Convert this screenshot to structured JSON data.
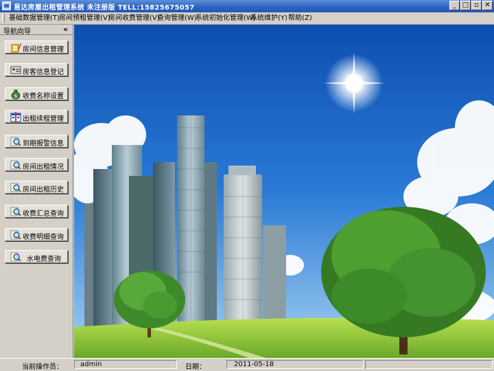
{
  "window": {
    "title": "易达房屋出租管理系统 未注册版  TELL:15825675057",
    "controls": {
      "minimize": "_",
      "maximize": "□",
      "restore": "▫",
      "close": "✕"
    }
  },
  "menu": {
    "items": [
      "基础数据管理(T)",
      "房间预租管理(V)",
      "房间收费管理(V)",
      "查询管理(W)",
      "系统初始化管理(W)",
      "系统维护(Y)",
      "帮助(Z)"
    ]
  },
  "nav": {
    "title": "导航向导",
    "collapse": "«",
    "items": [
      {
        "label": "房间信息管理",
        "icon": "house-edit-icon"
      },
      {
        "label": "房客信息登记",
        "icon": "tenant-card-icon"
      },
      {
        "label": "收费名称设置",
        "icon": "money-bag-icon"
      },
      {
        "label": "出租续租管理",
        "icon": "rent-calendar-icon"
      },
      {
        "label": "到期报警信息",
        "icon": "magnifier-alert-icon"
      },
      {
        "label": "房间出租情况",
        "icon": "magnifier-report-icon"
      },
      {
        "label": "房间出租历史",
        "icon": "magnifier-history-icon"
      },
      {
        "label": "收费汇总查询",
        "icon": "magnifier-summary-icon"
      },
      {
        "label": "收费明细查询",
        "icon": "magnifier-detail-icon"
      },
      {
        "label": "水电费查询",
        "icon": "magnifier-utility-icon"
      }
    ]
  },
  "status": {
    "operator_label": "当前操作员：",
    "operator_value": "admin",
    "date_label": "日期：",
    "date_value": "2011-05-18"
  },
  "colors": {
    "titlebar": "#2a62c4",
    "chrome": "#d4d0c8",
    "sky": "#1f68c8",
    "grass": "#8fca3a"
  }
}
